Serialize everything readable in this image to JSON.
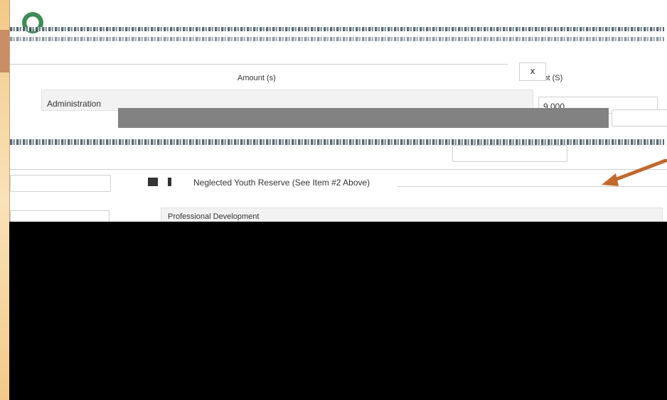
{
  "page": {
    "headers": {
      "col_amount": "Amount (s)",
      "col_amt": "Amt (S)"
    },
    "rows": {
      "administration_label": "Administration",
      "administration_value": "9,000",
      "neglected_youth_label": "Neglected Youth Reserve (See Item #2 Above)",
      "professional_development_label": "Professional Development"
    },
    "close_label": "x"
  },
  "colors": {
    "background": "#f6d9a6",
    "accent_arrow": "#c06a2e",
    "logo_green": "#3f8a58",
    "black_region": "#000000"
  },
  "icons": {
    "logo": "circular-seal-logo",
    "arrow": "pointer-arrow"
  }
}
